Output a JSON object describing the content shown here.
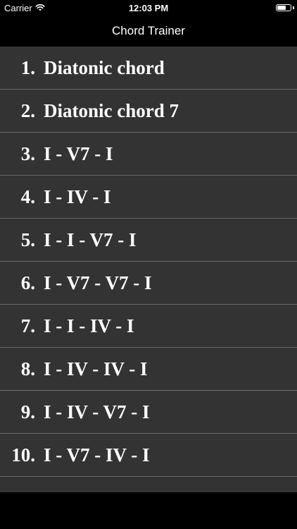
{
  "status_bar": {
    "carrier": "Carrier",
    "time": "12:03 PM"
  },
  "nav": {
    "title": "Chord Trainer"
  },
  "list": {
    "items": [
      {
        "number": "1.",
        "label": "Diatonic chord"
      },
      {
        "number": "2.",
        "label": "Diatonic chord 7"
      },
      {
        "number": "3.",
        "label": "I - V7 - I"
      },
      {
        "number": "4.",
        "label": "I - IV - I"
      },
      {
        "number": "5.",
        "label": "I - I - V7 - I"
      },
      {
        "number": "6.",
        "label": "I - V7 - V7 - I"
      },
      {
        "number": "7.",
        "label": "I - I - IV - I"
      },
      {
        "number": "8.",
        "label": "I - IV - IV - I"
      },
      {
        "number": "9.",
        "label": "I - IV - V7 - I"
      },
      {
        "number": "10.",
        "label": "I - V7 - IV - I"
      }
    ]
  },
  "colors": {
    "background": "#000000",
    "list_background": "#333333",
    "separator": "#6a6a6a",
    "text": "#ffffff"
  }
}
